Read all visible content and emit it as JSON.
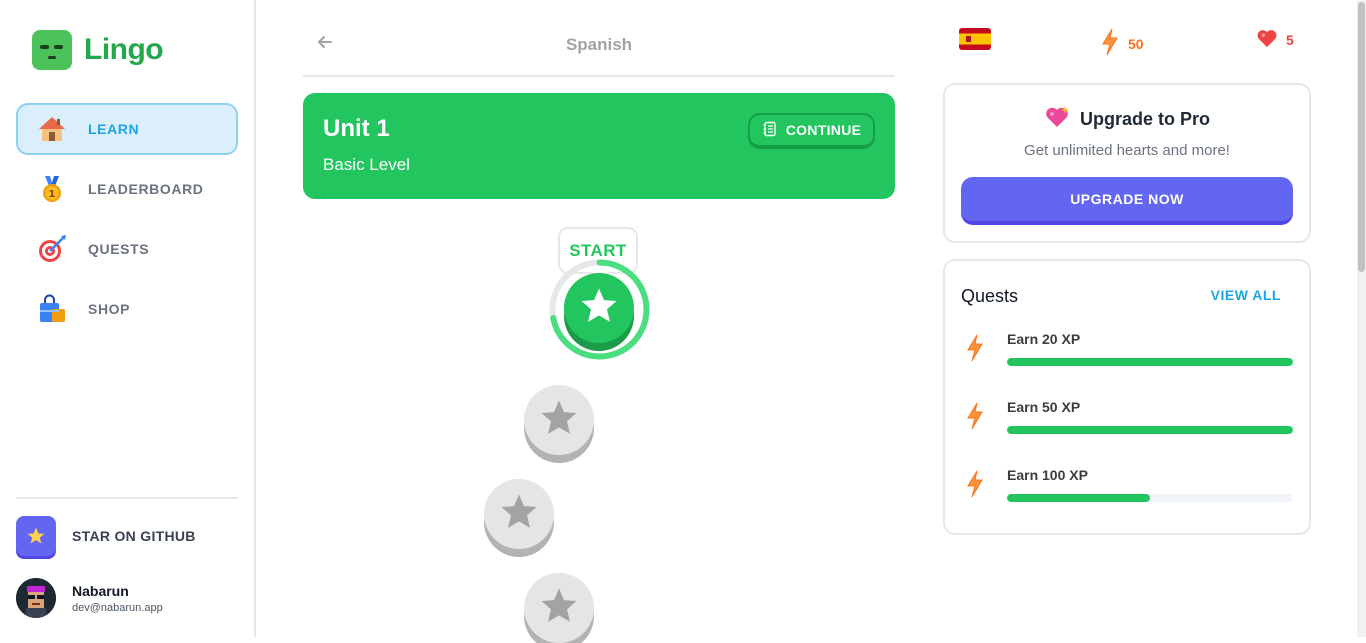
{
  "app": {
    "name": "Lingo"
  },
  "sidebar": {
    "items": [
      {
        "label": "LEARN",
        "icon": "house-icon",
        "active": true
      },
      {
        "label": "LEADERBOARD",
        "icon": "medal-icon",
        "active": false
      },
      {
        "label": "QUESTS",
        "icon": "target-icon",
        "active": false
      },
      {
        "label": "SHOP",
        "icon": "shopping-bag-icon",
        "active": false
      }
    ],
    "github_label": "STAR ON GITHUB",
    "user": {
      "name": "Nabarun",
      "email": "dev@nabarun.app"
    }
  },
  "header": {
    "title": "Spanish"
  },
  "unit": {
    "title": "Unit 1",
    "subtitle": "Basic Level",
    "continue_label": "CONTINUE"
  },
  "lessons": {
    "start_label": "START",
    "current_progress": 0.72
  },
  "stats": {
    "flag": "spain-flag-icon",
    "xp": "50",
    "hearts": "5"
  },
  "pro": {
    "title": "Upgrade to Pro",
    "subtitle": "Get unlimited hearts and more!",
    "button": "UPGRADE NOW"
  },
  "quests": {
    "title": "Quests",
    "view_all": "VIEW ALL",
    "items": [
      {
        "label": "Earn 20 XP",
        "progress": 1.0
      },
      {
        "label": "Earn 50 XP",
        "progress": 1.0
      },
      {
        "label": "Earn 100 XP",
        "progress": 0.5
      }
    ]
  },
  "colors": {
    "brand": "#22c55e",
    "accent_blue": "#1ea5e4",
    "pro": "#6366f1",
    "xp": "#f97316",
    "heart": "#ef4444"
  }
}
